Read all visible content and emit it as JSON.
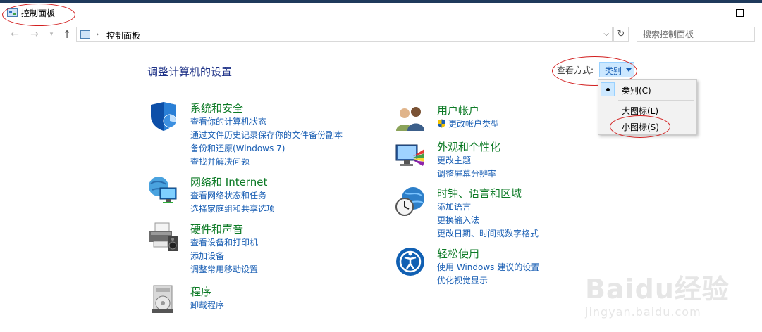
{
  "window": {
    "title": "控制面板",
    "minimize_icon": "minimize-icon",
    "maximize_icon": "maximize-icon"
  },
  "navigation": {
    "back_icon": "arrow-left-icon",
    "forward_icon": "arrow-right-icon",
    "recent_icon": "chevron-down-icon",
    "up_icon": "arrow-up-icon",
    "address_icon": "control-panel-icon",
    "address_separator": "›",
    "address_text": "控制面板",
    "address_dropdown_icon": "chevron-down-icon",
    "refresh_icon": "refresh-icon",
    "search_placeholder": "搜索控制面板"
  },
  "main": {
    "title": "调整计算机的设置",
    "view_by_label": "查看方式:",
    "view_by_value": "类别"
  },
  "categories_left": [
    {
      "title": "系统和安全",
      "icon": "shield-icon",
      "links": [
        "查看你的计算机状态",
        "通过文件历史记录保存你的文件备份副本",
        "备份和还原(Windows 7)",
        "查找并解决问题"
      ]
    },
    {
      "title": "网络和 Internet",
      "icon": "network-icon",
      "links": [
        "查看网络状态和任务",
        "选择家庭组和共享选项"
      ]
    },
    {
      "title": "硬件和声音",
      "icon": "printer-icon",
      "links": [
        "查看设备和打印机",
        "添加设备",
        "调整常用移动设置"
      ]
    },
    {
      "title": "程序",
      "icon": "programs-icon",
      "links": [
        "卸载程序"
      ]
    }
  ],
  "categories_right": [
    {
      "title": "用户帐户",
      "icon": "users-icon",
      "links": [
        "更改帐户类型"
      ],
      "link_icons": [
        "uac-shield-icon"
      ]
    },
    {
      "title": "外观和个性化",
      "icon": "appearance-icon",
      "links": [
        "更改主题",
        "调整屏幕分辨率"
      ]
    },
    {
      "title": "时钟、语言和区域",
      "icon": "clock-globe-icon",
      "links": [
        "添加语言",
        "更换输入法",
        "更改日期、时间或数字格式"
      ]
    },
    {
      "title": "轻松使用",
      "icon": "ease-of-access-icon",
      "links": [
        "使用 Windows 建议的设置",
        "优化视觉显示"
      ]
    }
  ],
  "view_menu": {
    "items": [
      {
        "label": "类别(C)",
        "selected": true
      },
      {
        "label": "大图标(L)",
        "selected": false
      },
      {
        "label": "小图标(S)",
        "selected": false
      }
    ]
  },
  "watermark": {
    "brand": "Baidu经验",
    "url": "jingyan.baidu.com"
  },
  "colors": {
    "category_title": "#0c7a25",
    "link": "#1a5fb4",
    "page_title": "#1e3287",
    "annotation": "#d21f1f",
    "menu_highlight": "#cce8ff"
  }
}
